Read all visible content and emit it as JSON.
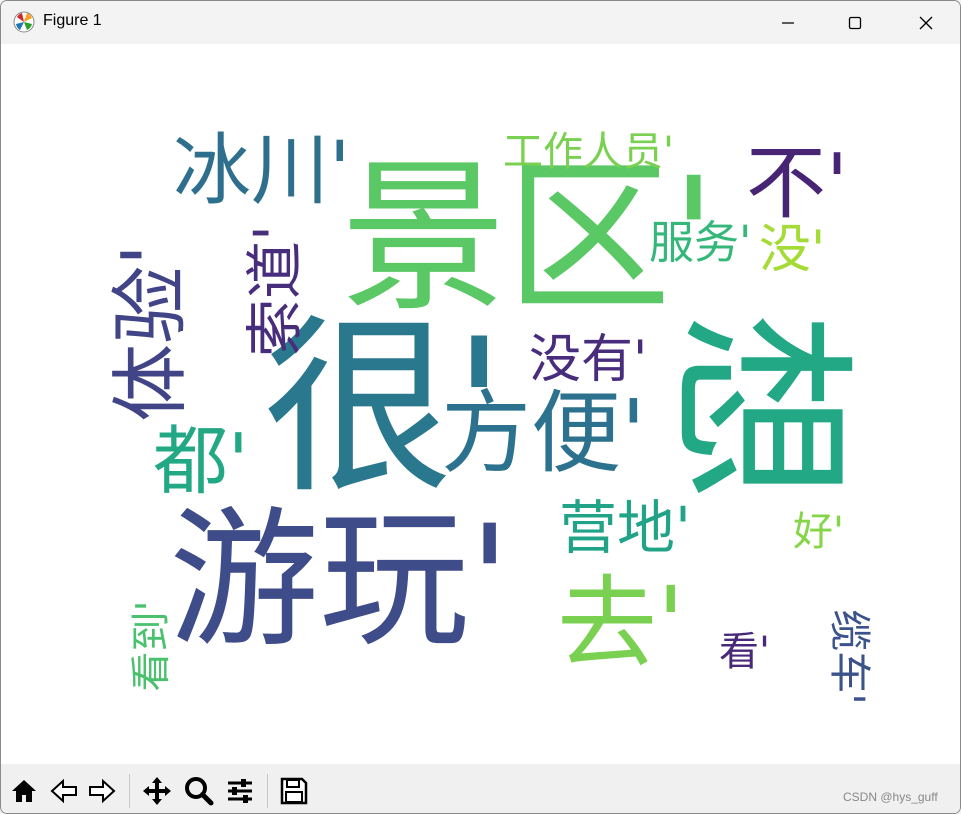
{
  "window": {
    "title": "Figure 1",
    "app_icon": "matplotlib-logo-icon"
  },
  "controls": {
    "minimize": "minimize-icon",
    "maximize": "maximize-icon",
    "close": "close-icon"
  },
  "wordcloud": {
    "palette": "viridis",
    "words": [
      {
        "text": "景区'",
        "color": "#5ac864",
        "rotated": false
      },
      {
        "text": "很'",
        "color": "#2a788e",
        "rotated": false
      },
      {
        "text": "游玩'",
        "color": "#3e4c8a",
        "rotated": false
      },
      {
        "text": "想",
        "color": "#22a884",
        "rotated": true
      },
      {
        "text": "不'",
        "color": "#482475",
        "rotated": false
      },
      {
        "text": "冰川'",
        "color": "#2e6f8e",
        "rotated": false
      },
      {
        "text": "体验'",
        "color": "#414487",
        "rotated": true
      },
      {
        "text": "索道'",
        "color": "#472d7b",
        "rotated": true
      },
      {
        "text": "方便'",
        "color": "#2c728e",
        "rotated": false
      },
      {
        "text": "工作人员'",
        "color": "#7ad151",
        "rotated": false
      },
      {
        "text": "服务'",
        "color": "#35b779",
        "rotated": false
      },
      {
        "text": "没'",
        "color": "#a5db36",
        "rotated": false
      },
      {
        "text": "没有'",
        "color": "#472d7b",
        "rotated": false
      },
      {
        "text": "都'",
        "color": "#22a884",
        "rotated": false
      },
      {
        "text": "营地'",
        "color": "#20a386",
        "rotated": false
      },
      {
        "text": "去'",
        "color": "#7ad151",
        "rotated": false
      },
      {
        "text": "好'",
        "color": "#86d549",
        "rotated": false
      },
      {
        "text": "看'",
        "color": "#482878",
        "rotated": false
      },
      {
        "text": "看到'",
        "color": "#4ac16d",
        "rotated": true
      },
      {
        "text": "缆车'",
        "color": "#3b528b",
        "rotated": true
      }
    ]
  },
  "toolbar": {
    "buttons": [
      {
        "name": "home-button",
        "icon": "home-icon"
      },
      {
        "name": "back-button",
        "icon": "back-arrow-icon"
      },
      {
        "name": "forward-button",
        "icon": "forward-arrow-icon"
      },
      {
        "name": "pan-button",
        "icon": "move-icon"
      },
      {
        "name": "zoom-button",
        "icon": "magnifier-icon"
      },
      {
        "name": "configure-subplots-button",
        "icon": "sliders-icon"
      },
      {
        "name": "save-button",
        "icon": "floppy-disk-icon"
      }
    ]
  },
  "watermark": "CSDN @hys_guff"
}
